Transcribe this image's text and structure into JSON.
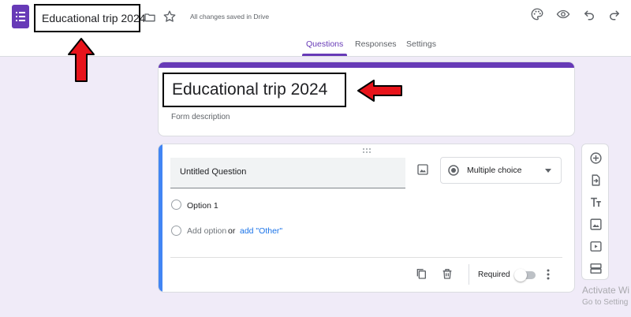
{
  "header": {
    "doc_title": "Educational trip 2024",
    "save_status": "All changes saved in Drive",
    "icons": [
      "forms-logo-icon",
      "folder-icon",
      "star-icon",
      "palette-icon",
      "preview-eye-icon",
      "undo-icon",
      "redo-icon"
    ]
  },
  "tabs": [
    {
      "label": "Questions",
      "active": true
    },
    {
      "label": "Responses",
      "active": false
    },
    {
      "label": "Settings",
      "active": false
    }
  ],
  "form": {
    "title": "Educational trip 2024",
    "description_placeholder": "Form description"
  },
  "question": {
    "title_placeholder": "Untitled Question",
    "type": "Multiple choice",
    "options": [
      "Option 1"
    ],
    "add_option": "Add option",
    "or_text": "or",
    "add_other": "add \"Other\"",
    "required_label": "Required",
    "required": false
  },
  "side_toolbar": {
    "icons": [
      "add-question-icon",
      "import-questions-icon",
      "add-title-icon",
      "add-image-icon",
      "add-video-icon",
      "add-section-icon"
    ]
  },
  "watermark": {
    "line1": "Activate Wi",
    "line2": "Go to Setting"
  },
  "colors": {
    "brand": "#673ab7",
    "active_question_bar": "#4285f4",
    "background": "#f0ebf8",
    "annotation_arrow": "#e8141b"
  }
}
